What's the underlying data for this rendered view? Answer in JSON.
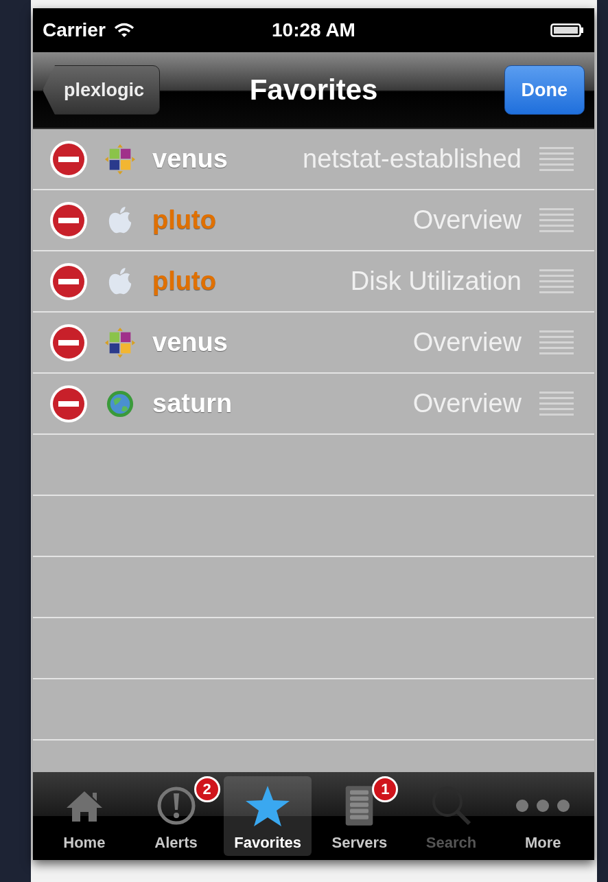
{
  "status_bar": {
    "carrier": "Carrier",
    "time": "10:28 AM"
  },
  "nav_bar": {
    "back": "plexlogic",
    "title": "Favorites",
    "done": "Done"
  },
  "favorites": [
    {
      "kind": "grid",
      "host": "venus",
      "color": "#ffffff",
      "view": "netstat-established"
    },
    {
      "kind": "apple",
      "host": "pluto",
      "color": "#e07000",
      "view": "Overview"
    },
    {
      "kind": "apple",
      "host": "pluto",
      "color": "#e07000",
      "view": "Disk Utilization"
    },
    {
      "kind": "grid",
      "host": "venus",
      "color": "#ffffff",
      "view": "Overview"
    },
    {
      "kind": "globe",
      "host": "saturn",
      "color": "#ffffff",
      "view": "Overview"
    }
  ],
  "tabs": [
    {
      "kind": "home",
      "label": "Home",
      "selected": false,
      "disabled": false
    },
    {
      "kind": "alert",
      "label": "Alerts",
      "badge": "2",
      "selected": false,
      "disabled": false
    },
    {
      "kind": "star",
      "label": "Favorites",
      "selected": true,
      "disabled": false
    },
    {
      "kind": "server",
      "label": "Servers",
      "badge": "1",
      "selected": false,
      "disabled": false
    },
    {
      "kind": "search",
      "label": "Search",
      "selected": false,
      "disabled": true
    },
    {
      "kind": "more",
      "label": "More",
      "selected": false,
      "disabled": false
    }
  ]
}
